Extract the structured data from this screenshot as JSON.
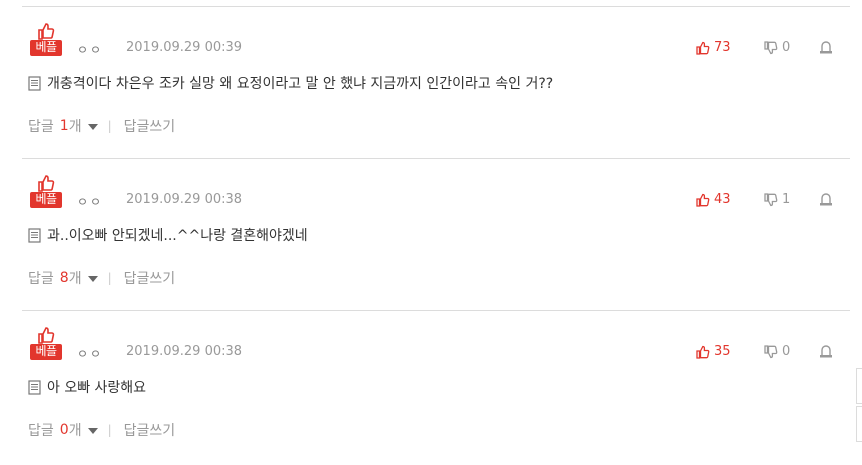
{
  "best_label": "베플",
  "reply_label": "답글",
  "reply_unit": "개",
  "write_reply_label": "답글쓰기",
  "comments": [
    {
      "nickname": "ㅇㅇ",
      "date": "2019.09.29 00:39",
      "likes": "73",
      "dislikes": "0",
      "text": "개충격이다 차은우 조카 실망 왜 요정이라고 말 안 했냐 지금까지 인간이라고 속인 거??",
      "reply_count": "1"
    },
    {
      "nickname": "ㅇㅇ",
      "date": "2019.09.29 00:38",
      "likes": "43",
      "dislikes": "1",
      "text": "과..이오빠 안되겠네...^^나랑 결혼해야겠네",
      "reply_count": "8"
    },
    {
      "nickname": "ㅇㅇ",
      "date": "2019.09.29 00:38",
      "likes": "35",
      "dislikes": "0",
      "text": "아 오빠 사랑해요",
      "reply_count": "0"
    }
  ],
  "colors": {
    "accent": "#e2362d",
    "muted": "#999999",
    "divider": "#dcdcdc"
  },
  "icons": [
    "thumbs-up-icon",
    "thumbs-down-icon",
    "report-icon",
    "memo-icon",
    "caret-down-icon"
  ]
}
